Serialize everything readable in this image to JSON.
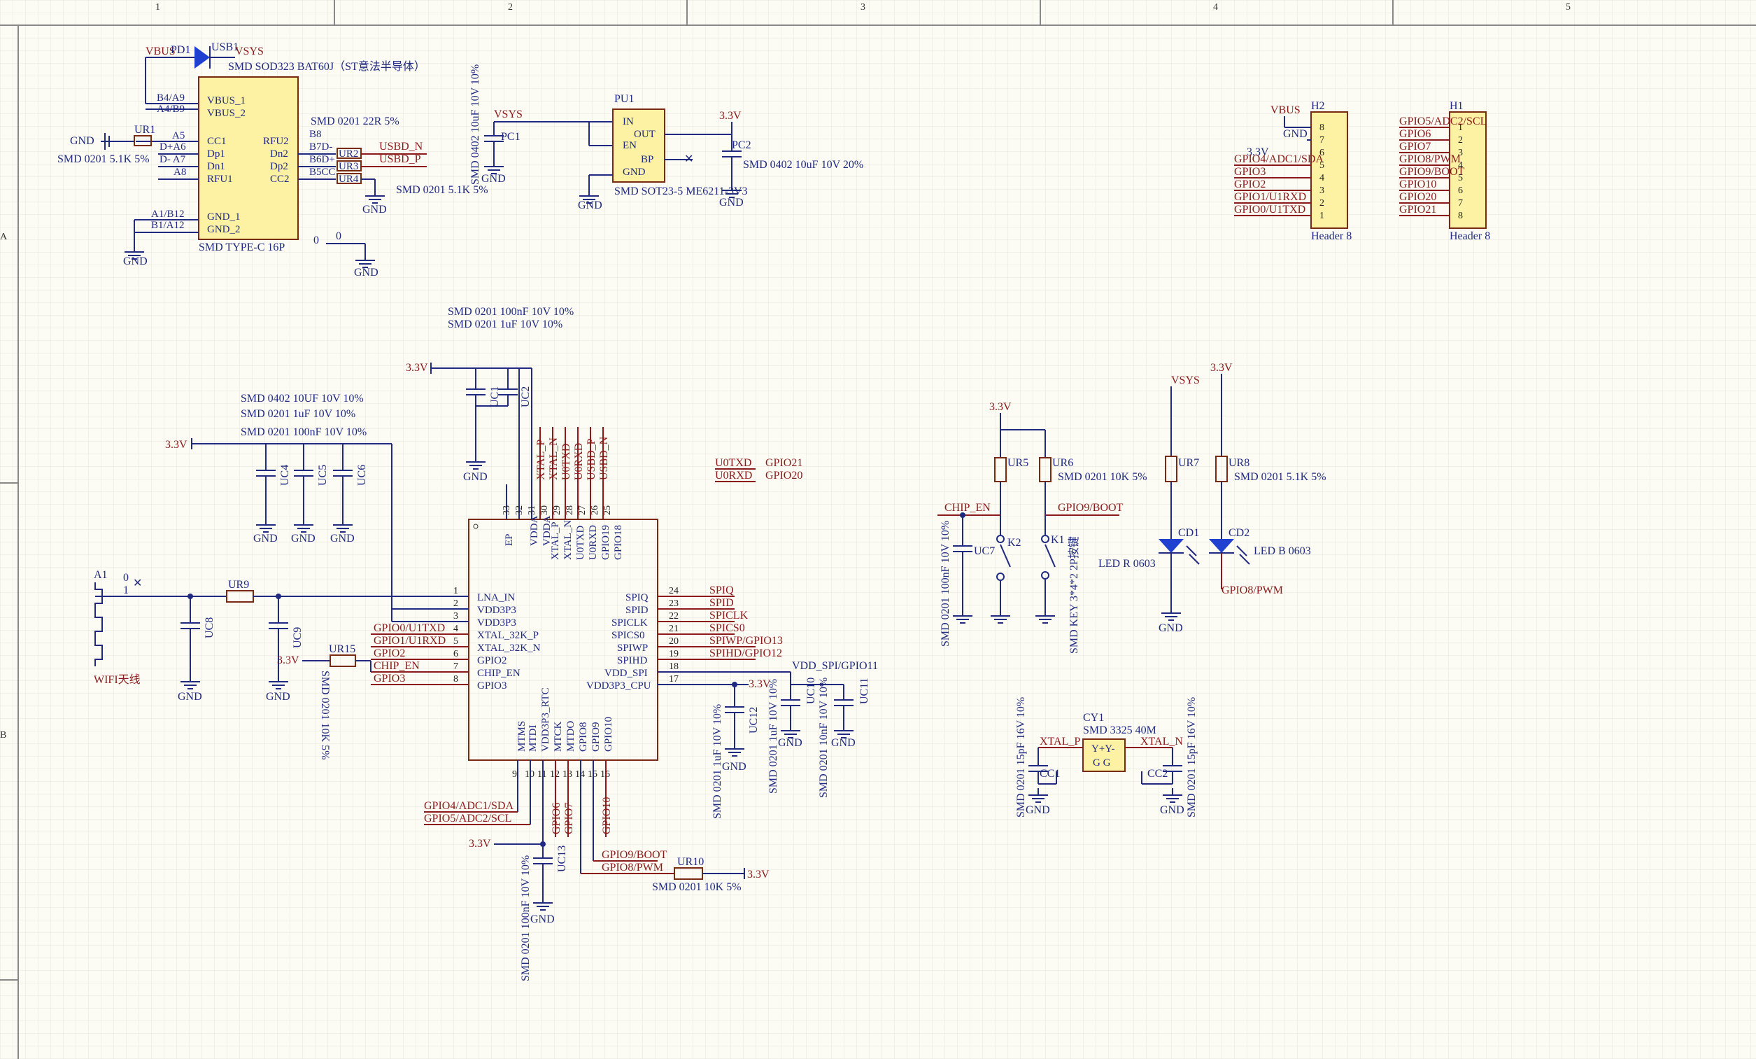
{
  "zones": [
    "1",
    "2",
    "3",
    "4",
    "5"
  ],
  "row_labels": [
    "A",
    "B"
  ],
  "usb": {
    "diode_ref": "PD1",
    "diode_desc": "SMD SOD323 BAT60J（ST意法半导体）",
    "conn_ref": "USB1",
    "conn_desc": "SMD TYPE-C 16P",
    "vbus": "VBUS",
    "vsys": "VSYS",
    "gnd": "GND",
    "res_ur1": "UR1",
    "res_ur1_desc": "SMD 0201 5.1K 5%",
    "res_dp": "SMD 0201 22R 5%",
    "res_cc": "SMD 0201 5.1K 5%",
    "ur2": "UR2",
    "ur3": "UR3",
    "ur4": "UR4",
    "usbd_n": "USBD_N",
    "usbd_p": "USBD_P",
    "pins_left": [
      "B4/A9",
      "A4/B9",
      "CC1",
      "Dp1",
      "Dn1",
      "RFU1",
      "A1/B12",
      "B1/A12"
    ],
    "pins_left_names": [
      "VBUS_1",
      "VBUS_2",
      "CC1",
      "Dp1",
      "Dn1",
      "RFU1",
      "GND_1",
      "GND_2"
    ],
    "pins_left_nums": [
      "A5",
      "D+A6",
      "D- A7",
      "A8"
    ],
    "pins_right_names": [
      "RFU2",
      "Dn2",
      "Dp2",
      "CC2"
    ],
    "pins_right_nums": [
      "B8",
      "B7D-",
      "B6D+",
      "B5CC"
    ],
    "zero_a": "0",
    "zero_b": "0"
  },
  "ldo": {
    "ref": "PU1",
    "desc": "SMD SOT23-5 ME6211-3V3",
    "pins": [
      "IN",
      "EN",
      "GND",
      "OUT",
      "BP"
    ],
    "c_in": "PC1",
    "c_in_desc": "SMD 0402 10uF 10V 10%",
    "c_out": "PC2",
    "c_out_desc": "SMD 0402 10uF 10V 20%",
    "vsys": "VSYS",
    "v33": "3.3V",
    "gnd": "GND"
  },
  "h2": {
    "ref": "H2",
    "desc": "Header 8",
    "nets": [
      "VBUS",
      "GND",
      "3.3V",
      "GPIO4/ADC1/SDA",
      "GPIO3",
      "GPIO2",
      "GPIO1/U1RXD",
      "GPIO0/U1TXD"
    ],
    "pins": [
      "8",
      "7",
      "6",
      "5",
      "4",
      "3",
      "2",
      "1"
    ]
  },
  "h1": {
    "ref": "H1",
    "desc": "Header 8",
    "nets": [
      "GPIO5/ADC2/SCL",
      "GPIO6",
      "GPIO7",
      "GPIO8/PWM",
      "GPIO9/BOOT",
      "GPIO10",
      "GPIO20",
      "GPIO21"
    ],
    "pins": [
      "1",
      "2",
      "3",
      "4",
      "5",
      "6",
      "7",
      "8"
    ]
  },
  "decap_top": {
    "desc1": "SMD 0201 100nF 10V 10%",
    "desc2": "SMD 0201 1uF 10V 10%",
    "c1": "UC1",
    "c2": "UC2",
    "v33": "3.3V",
    "gnd": "GND"
  },
  "decap_left": {
    "desc1": "SMD 0402 10UF 10V 10%",
    "desc2": "SMD 0201 1uF 10V 10%",
    "desc3": "SMD 0201 100nF 10V 10%",
    "c4": "UC4",
    "c5": "UC5",
    "c6": "UC6",
    "v33": "3.3V",
    "gnd": "GND"
  },
  "mcu": {
    "left_pins": [
      "LNA_IN",
      "VDD3P3",
      "VDD3P3",
      "XTAL_32K_P",
      "XTAL_32K_N",
      "GPIO2",
      "CHIP_EN",
      "GPIO3"
    ],
    "left_nums": [
      "1",
      "2",
      "3",
      "4",
      "5",
      "6",
      "7",
      "8"
    ],
    "left_nets": [
      "GPIO0/U1TXD",
      "GPIO1/U1RXD",
      "GPIO2",
      "CHIP_EN",
      "GPIO3"
    ],
    "right_pins": [
      "SPIQ",
      "SPID",
      "SPICLK",
      "SPICS0",
      "SPIWP",
      "SPIHD",
      "VDD_SPI",
      "VDD3P3_CPU"
    ],
    "right_nums": [
      "24",
      "23",
      "22",
      "21",
      "20",
      "19",
      "18",
      "17"
    ],
    "right_nets": [
      "SPIQ",
      "SPID",
      "SPICLK",
      "SPICS0",
      "SPIWP/GPIO13",
      "SPIHD/GPIO12"
    ],
    "vdd_spi_net": "VDD_SPI/GPIO11",
    "top_pins": [
      "EP",
      "VDDA",
      "VDDA",
      "XTAL_P",
      "XTAL_N",
      "U0TXD",
      "U0RXD",
      "GPIO19",
      "GPIO18"
    ],
    "top_nums": [
      "33",
      "32",
      "31",
      "30",
      "29",
      "28",
      "27",
      "26",
      "25"
    ],
    "top_nets": [
      "XTAL_P",
      "XTAL_N",
      "U0TXD",
      "U0RXD",
      "USBD_P",
      "USBD_N"
    ],
    "bottom_pins": [
      "MTMS",
      "MTDI",
      "VDD3P3_RTC",
      "MTCK",
      "MTDO",
      "GPIO8",
      "GPIO9",
      "GPIO10"
    ],
    "bottom_nums": [
      "9",
      "10",
      "11",
      "12",
      "13",
      "14",
      "15",
      "16"
    ],
    "bottom_nets": [
      "GPIO4/ADC1/SDA",
      "GPIO5/ADC2/SCL",
      "GPIO6",
      "GPIO7",
      "GPIO10",
      "GPIO9/BOOT",
      "GPIO8/PWM"
    ],
    "uart_map": [
      "U0TXD",
      "GPIO21",
      "U0RXD",
      "GPIO20"
    ]
  },
  "rf": {
    "ant_ref": "A1",
    "ant_desc": "WIFI天线",
    "zero": "0",
    "one": "1",
    "r9": "UR9",
    "c8": "UC8",
    "c9": "UC9",
    "r15": "UR15",
    "r15_desc": "SMD 0201 10K 5%",
    "v33": "3.3V",
    "gnd": "GND"
  },
  "caps_right": {
    "c12": "UC12",
    "c12_desc": "SMD 0201 1uF 10V 10%",
    "c10": "UC10",
    "c10_desc": "SMD 0201 1uF 10V 10%",
    "c11": "UC11",
    "c11_desc": "SMD 0201 10nF 10V 10%",
    "v33": "3.3V",
    "gnd": "GND"
  },
  "caps_bottom": {
    "c13": "UC13",
    "c13_desc": "SMD 0201 100nF 10V 10%",
    "r10": "UR10",
    "r10_desc": "SMD 0201 10K 5%",
    "v33": "3.3V",
    "gnd": "GND"
  },
  "buttons": {
    "v33": "3.3V",
    "r5": "UR5",
    "r6": "UR6",
    "r_desc": "SMD 0201 10K 5%",
    "chip_en": "CHIP_EN",
    "boot": "GPIO9/BOOT",
    "c7": "UC7",
    "c7_desc": "SMD 0201 100nF 10V 10%",
    "k2": "K2",
    "k1": "K1",
    "k_desc": "SMD KEY 3*4*2 2P按键"
  },
  "leds": {
    "vsys": "VSYS",
    "v33": "3.3V",
    "r7": "UR7",
    "r8": "UR8",
    "r_desc": "SMD 0201 5.1K 5%",
    "cd1": "CD1",
    "cd1_desc": "LED R 0603",
    "cd2": "CD2",
    "cd2_desc": "LED B 0603",
    "pwm": "GPIO8/PWM",
    "gnd": "GND"
  },
  "crystal": {
    "ref": "CY1",
    "desc": "SMD 3325 40M",
    "xp": "XTAL_P",
    "xn": "XTAL_N",
    "pins": "Y+Y-",
    "pins2": "G  G",
    "cc1": "CC1",
    "cc2": "CC2",
    "c_desc": "SMD 0201 15pF 16V 10%",
    "gnd": "GND"
  }
}
